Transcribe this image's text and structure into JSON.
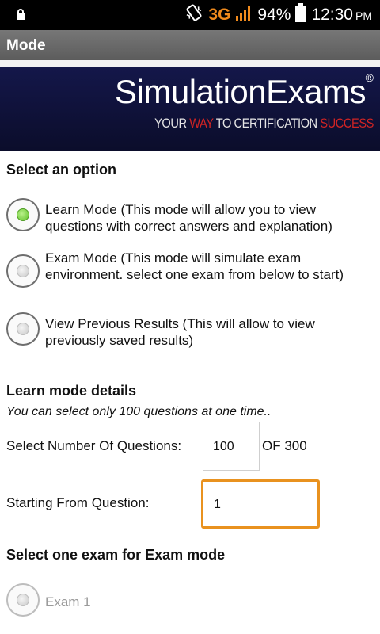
{
  "status_bar": {
    "network": "3G",
    "battery": "94%",
    "time": "12:30",
    "ampm": "PM"
  },
  "action_bar": {
    "title": "Mode"
  },
  "banner": {
    "brand": "SimulationExams",
    "registered": "®",
    "tagline_parts": [
      "YOUR ",
      "WAY",
      " TO CERTIFICATION ",
      "SUCCESS"
    ]
  },
  "mode_section": {
    "heading": "Select an option",
    "options": [
      {
        "label": "Learn Mode      (This mode will allow you to view questions with correct answers and explanation)",
        "checked": true
      },
      {
        "label": "Exam Mode  (This mode will simulate exam environment. select one exam from below to start)",
        "checked": false
      },
      {
        "label": "View Previous Results    (This will allow to view previously saved results)",
        "checked": false
      }
    ]
  },
  "learn_details": {
    "heading": "Learn mode details",
    "note": "You can select only 100 questions at one time..",
    "num_questions_label": "Select Number Of Questions:",
    "num_questions_value": "100",
    "of_total": "OF 300",
    "start_label": "Starting From Question:",
    "start_value": "1"
  },
  "exam_section": {
    "heading": "Select one exam for Exam mode",
    "exams": [
      {
        "label": "Exam 1",
        "enabled": false
      }
    ]
  },
  "colors": {
    "accent_orange": "#e9921f",
    "radio_checked": "#5fc22a",
    "banner_bg": "#0b0d2b",
    "tagline_red": "#d12424"
  }
}
